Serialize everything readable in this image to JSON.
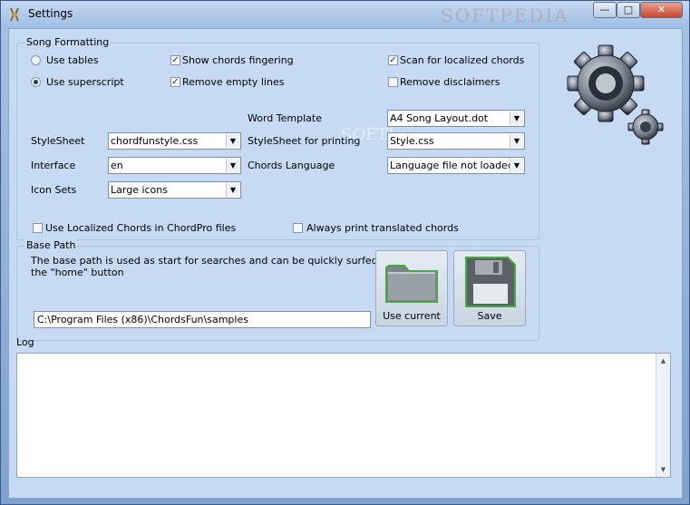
{
  "window": {
    "title": "Settings",
    "watermark_title": "SOFTPEDIA",
    "minimize": "—",
    "maximize": "□",
    "close": "✕"
  },
  "song_formatting": {
    "title": "Song Formatting",
    "use_tables": "Use tables",
    "use_superscript": "Use superscript",
    "show_chords_fingering": "Show chords fingering",
    "remove_empty_lines": "Remove empty lines",
    "scan_localized_chords": "Scan for localized chords",
    "remove_disclaimers": "Remove disclaimers",
    "selected_mode": "use_superscript",
    "word_template": {
      "label": "Word Template",
      "value": "A4 Song Layout.dot"
    },
    "stylesheet": {
      "label": "StyleSheet",
      "value": "chordfunstyle.css"
    },
    "stylesheet_printing": {
      "label": "StyleSheet for printing",
      "value": "Style.css"
    },
    "interface": {
      "label": "Interface",
      "value": "en"
    },
    "chords_language": {
      "label": "Chords Language",
      "value": "Language file not loaded"
    },
    "icon_sets": {
      "label": "Icon Sets",
      "value": "Large icons"
    },
    "use_localized_chordpro": "Use Localized Chords in ChordPro files",
    "always_print_translated": "Always print translated chords",
    "watermark": "SOFTI"
  },
  "base_path": {
    "title": "Base Path",
    "description_line1": "The base path is used as start for searches and can be quickly surfed to using",
    "description_line2": "the \"home\" button",
    "path": "C:\\Program Files (x86)\\ChordsFun\\samples",
    "use_current": "Use current",
    "save": "Save"
  },
  "log": {
    "title": "Log"
  },
  "icons": {
    "app": "guitar-icon",
    "settings": "gear-icon",
    "folder": "folder-icon",
    "save": "floppy-disk-icon"
  }
}
